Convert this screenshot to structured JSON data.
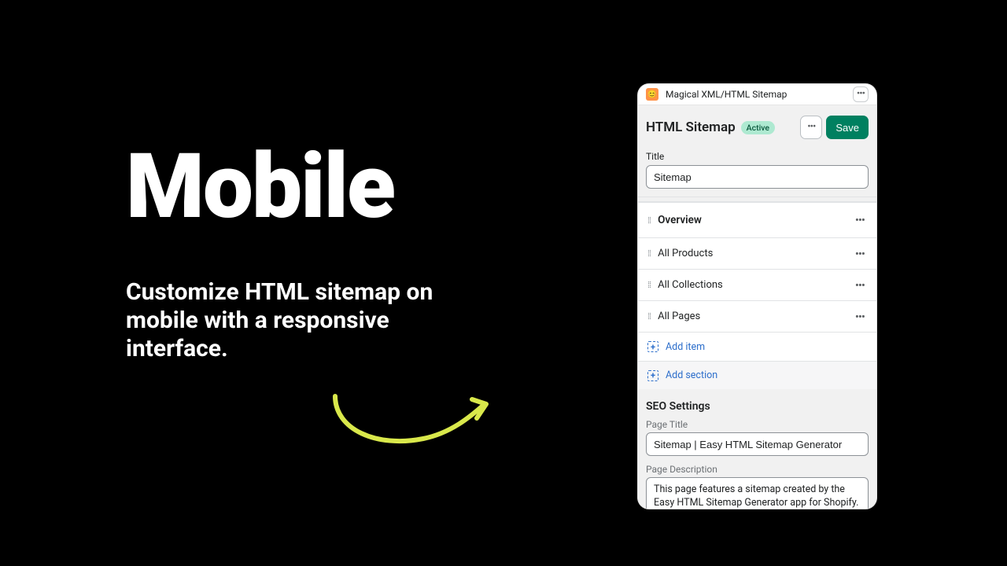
{
  "marketing": {
    "headline": "Mobile",
    "subtext": "Customize HTML sitemap on mobile with a responsive interface."
  },
  "app": {
    "name": "Magical XML/HTML Sitemap",
    "icon": "😊"
  },
  "page": {
    "title": "HTML Sitemap",
    "status": "Active",
    "saveLabel": "Save"
  },
  "titleField": {
    "label": "Title",
    "value": "Sitemap"
  },
  "sections": {
    "overview": "Overview",
    "items": [
      "All Products",
      "All Collections",
      "All Pages"
    ],
    "addItem": "Add item",
    "addSection": "Add section"
  },
  "seo": {
    "heading": "SEO Settings",
    "pageTitleLabel": "Page Title",
    "pageTitleValue": "Sitemap | Easy HTML Sitemap Generator",
    "pageDescLabel": "Page Description",
    "pageDescValue": "This page features a sitemap created by the Easy HTML Sitemap Generator app for Shopify."
  }
}
